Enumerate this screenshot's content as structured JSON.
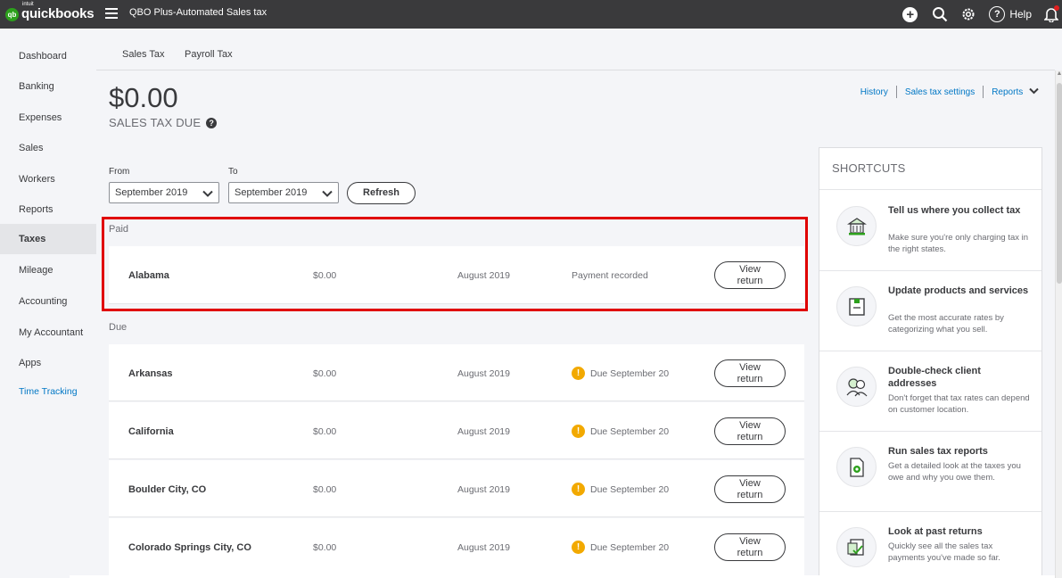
{
  "header": {
    "logo_brand": "intuit",
    "logo_name": "quickbooks",
    "company": "QBO Plus-Automated Sales tax",
    "help_label": "Help"
  },
  "sidebar": {
    "items": [
      {
        "label": "Dashboard"
      },
      {
        "label": "Banking"
      },
      {
        "label": "Expenses"
      },
      {
        "label": "Sales"
      },
      {
        "label": "Workers"
      },
      {
        "label": "Reports"
      },
      {
        "label": "Taxes"
      },
      {
        "label": "Mileage"
      },
      {
        "label": "Accounting"
      },
      {
        "label": "My Accountant"
      },
      {
        "label": "Apps"
      },
      {
        "label": "Time Tracking"
      }
    ],
    "active": "Taxes"
  },
  "tabs": [
    "Sales Tax",
    "Payroll Tax"
  ],
  "summary": {
    "amount": "$0.00",
    "label": "SALES TAX DUE"
  },
  "links": {
    "history": "History",
    "settings": "Sales tax settings",
    "reports": "Reports"
  },
  "filters": {
    "from_label": "From",
    "from_value": "September 2019",
    "to_label": "To",
    "to_value": "September 2019",
    "refresh_label": "Refresh"
  },
  "paid": {
    "label": "Paid",
    "rows": [
      {
        "state": "Alabama",
        "amount": "$0.00",
        "period": "August 2019",
        "status": "Payment recorded",
        "button": "View return"
      }
    ]
  },
  "due": {
    "label": "Due",
    "rows": [
      {
        "state": "Arkansas",
        "amount": "$0.00",
        "period": "August 2019",
        "status": "Due September 20",
        "button": "View return"
      },
      {
        "state": "California",
        "amount": "$0.00",
        "period": "August 2019",
        "status": "Due September 20",
        "button": "View return"
      },
      {
        "state": "Boulder City, CO",
        "amount": "$0.00",
        "period": "August 2019",
        "status": "Due September 20",
        "button": "View return"
      },
      {
        "state": "Colorado Springs City, CO",
        "amount": "$0.00",
        "period": "August 2019",
        "status": "Due September 20",
        "button": "View return"
      }
    ]
  },
  "shortcuts": {
    "title": "SHORTCUTS",
    "items": [
      {
        "title": "Tell us where you collect tax",
        "desc": "Make sure you're only charging tax in the right states.",
        "icon": "building-icon"
      },
      {
        "title": "Update products and services",
        "desc": "Get the most accurate rates by categorizing what you sell.",
        "icon": "box-icon"
      },
      {
        "title": "Double-check client addresses",
        "desc": "Don't forget that tax rates can depend on customer location.",
        "icon": "people-icon"
      },
      {
        "title": "Run sales tax reports",
        "desc": "Get a detailed look at the taxes you owe and why you owe them.",
        "icon": "report-icon"
      },
      {
        "title": "Look at past returns",
        "desc": "Quickly see all the sales tax payments you've made so far.",
        "icon": "returns-icon"
      }
    ]
  },
  "colors": {
    "topbar": "#3a3a3c",
    "brand_green": "#2ca01c",
    "link_blue": "#0077c5",
    "warning": "#f2a900",
    "highlight_red": "#e00000"
  }
}
